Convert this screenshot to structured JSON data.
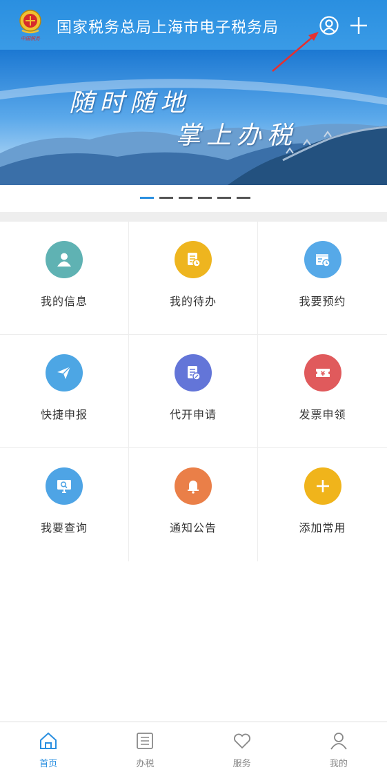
{
  "header": {
    "title": "国家税务总局上海市电子税务局",
    "logo_caption": "中国税务",
    "user_icon": "user-circle-icon",
    "add_icon": "plus-icon"
  },
  "banner": {
    "slogan_line1": "随时随地",
    "slogan_line2": "掌上办税",
    "carousel": {
      "pages": 6,
      "active": 1
    }
  },
  "grid": [
    {
      "label": "我的信息",
      "icon": "user-icon",
      "color": "#5fb2b3"
    },
    {
      "label": "我的待办",
      "icon": "document-clock-icon",
      "color": "#eeb51f"
    },
    {
      "label": "我要预约",
      "icon": "calendar-clock-icon",
      "color": "#56a9e8"
    },
    {
      "label": "快捷申报",
      "icon": "paper-plane-icon",
      "color": "#4da6e4"
    },
    {
      "label": "代开申请",
      "icon": "document-edit-icon",
      "color": "#6375d8"
    },
    {
      "label": "发票申领",
      "icon": "ticket-yen-icon",
      "color": "#e05a5c"
    },
    {
      "label": "我要查询",
      "icon": "monitor-search-icon",
      "color": "#4ea4e5"
    },
    {
      "label": "通知公告",
      "icon": "bell-icon",
      "color": "#ea7f48"
    },
    {
      "label": "添加常用",
      "icon": "plus-icon",
      "color": "#f0b41b"
    }
  ],
  "tabbar": {
    "items": [
      {
        "label": "首页",
        "icon": "home-icon",
        "active": true
      },
      {
        "label": "办税",
        "icon": "list-icon",
        "active": false
      },
      {
        "label": "服务",
        "icon": "heart-icon",
        "active": false
      },
      {
        "label": "我的",
        "icon": "person-icon",
        "active": false
      }
    ]
  },
  "colors": {
    "primary": "#2a8fe0",
    "annotation_arrow": "#e53030"
  }
}
